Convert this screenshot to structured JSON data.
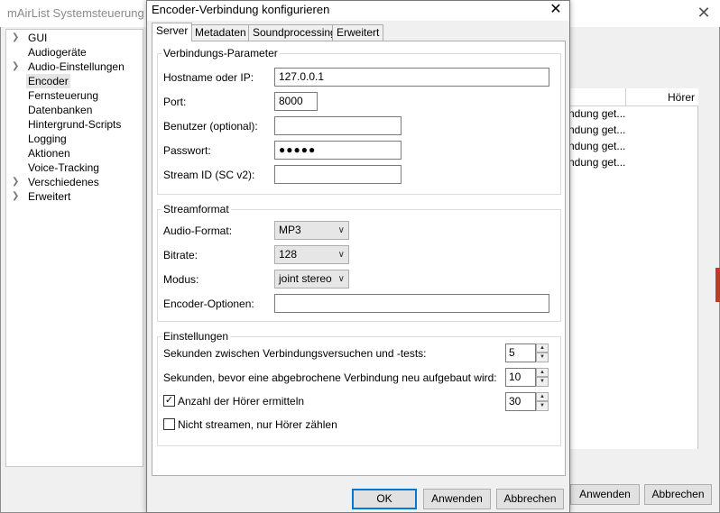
{
  "background": {
    "title": "mAirList Systemsteuerung",
    "close_glyph": "✕",
    "tree": [
      {
        "label": "GUI",
        "expandable": true
      },
      {
        "label": "Audiogeräte",
        "expandable": false
      },
      {
        "label": "Audio-Einstellungen",
        "expandable": true
      },
      {
        "label": "Encoder",
        "expandable": false,
        "selected": true
      },
      {
        "label": "Fernsteuerung",
        "expandable": false
      },
      {
        "label": "Datenbanken",
        "expandable": false
      },
      {
        "label": "Hintergrund-Scripts",
        "expandable": false
      },
      {
        "label": "Logging",
        "expandable": false
      },
      {
        "label": "Aktionen",
        "expandable": false
      },
      {
        "label": "Voice-Tracking",
        "expandable": false
      },
      {
        "label": "Verschiedenes",
        "expandable": true
      },
      {
        "label": "Erweitert",
        "expandable": true
      }
    ],
    "list_header": "Hörer",
    "list_rows": [
      "ndung get...",
      "ndung get...",
      "ndung get...",
      "ndung get..."
    ],
    "apply_label": "Anwenden",
    "cancel_label": "Abbrechen"
  },
  "dialog": {
    "title": "Encoder-Verbindung konfigurieren",
    "close_glyph": "✕",
    "tabs": [
      {
        "label": "Server",
        "active": true
      },
      {
        "label": "Metadaten",
        "active": false
      },
      {
        "label": "Soundprocessing",
        "active": false
      },
      {
        "label": "Erweitert",
        "active": false
      }
    ],
    "connection": {
      "group_title": "Verbindungs-Parameter",
      "hostname_label": "Hostname oder IP:",
      "hostname_value": "127.0.0.1",
      "port_label": "Port:",
      "port_value": "8000",
      "user_label": "Benutzer (optional):",
      "user_value": "",
      "password_label": "Passwort:",
      "password_value": "●●●●●",
      "streamid_label": "Stream ID (SC v2):",
      "streamid_value": ""
    },
    "streamformat": {
      "group_title": "Streamformat",
      "audioformat_label": "Audio-Format:",
      "audioformat_value": "MP3",
      "bitrate_label": "Bitrate:",
      "bitrate_value": "128",
      "mode_label": "Modus:",
      "mode_value": "joint stereo",
      "options_label": "Encoder-Optionen:",
      "options_value": ""
    },
    "settings": {
      "group_title": "Einstellungen",
      "retry_label": "Sekunden zwischen Verbindungsversuchen und -tests:",
      "retry_value": "5",
      "reconnect_label": "Sekunden, bevor eine abgebrochene Verbindung neu aufgebaut wird:",
      "reconnect_value": "10",
      "listeners_label": "Anzahl der Hörer ermitteln",
      "listeners_checked": true,
      "listeners_value": "30",
      "nostream_label": "Nicht streamen, nur Hörer zählen",
      "nostream_checked": false
    },
    "buttons": {
      "ok": "OK",
      "apply": "Anwenden",
      "cancel": "Abbrechen"
    }
  }
}
